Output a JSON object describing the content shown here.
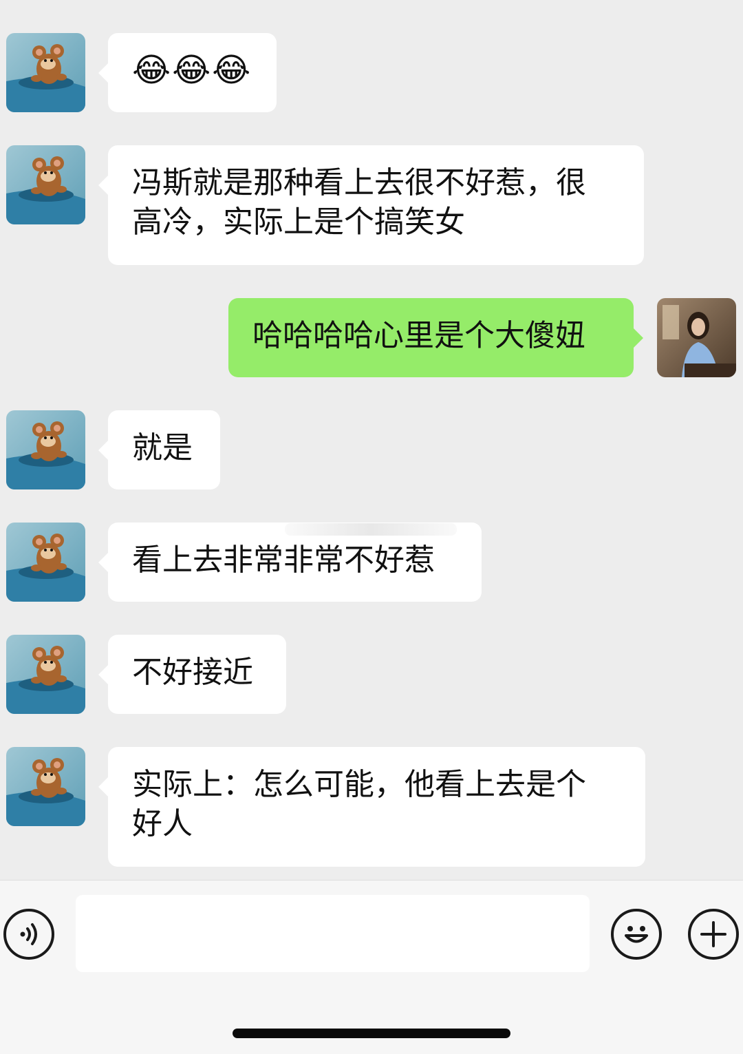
{
  "messages": [
    {
      "id": 1,
      "side": "in",
      "emoji": "😂😂😂"
    },
    {
      "id": 2,
      "side": "in",
      "lines": [
        "冯斯就是那种看上去很不好惹，很",
        "高冷，实际上是个搞笑女"
      ]
    },
    {
      "id": 3,
      "side": "out",
      "lines": [
        "哈哈哈哈心里是个大傻妞"
      ]
    },
    {
      "id": 4,
      "side": "in",
      "lines": [
        "就是"
      ]
    },
    {
      "id": 5,
      "side": "in",
      "lines": [
        "看上去非常非常不好惹"
      ]
    },
    {
      "id": 6,
      "side": "in",
      "lines": [
        "不好接近"
      ]
    },
    {
      "id": 7,
      "side": "in",
      "lines": [
        "实际上：怎么可能，他看上去是个",
        "好人"
      ]
    }
  ],
  "contact_avatar_icon": "jerry-mouse-avatar-icon",
  "self_avatar_icon": "user-photo-avatar-icon",
  "input_bar": {
    "voice_icon": "voice-input-icon",
    "emoji_icon": "emoji-smile-icon",
    "plus_icon": "plus-icon",
    "text_value": ""
  },
  "colors": {
    "background": "#ededed",
    "incoming_bubble": "#ffffff",
    "outgoing_bubble": "#95ec69"
  }
}
